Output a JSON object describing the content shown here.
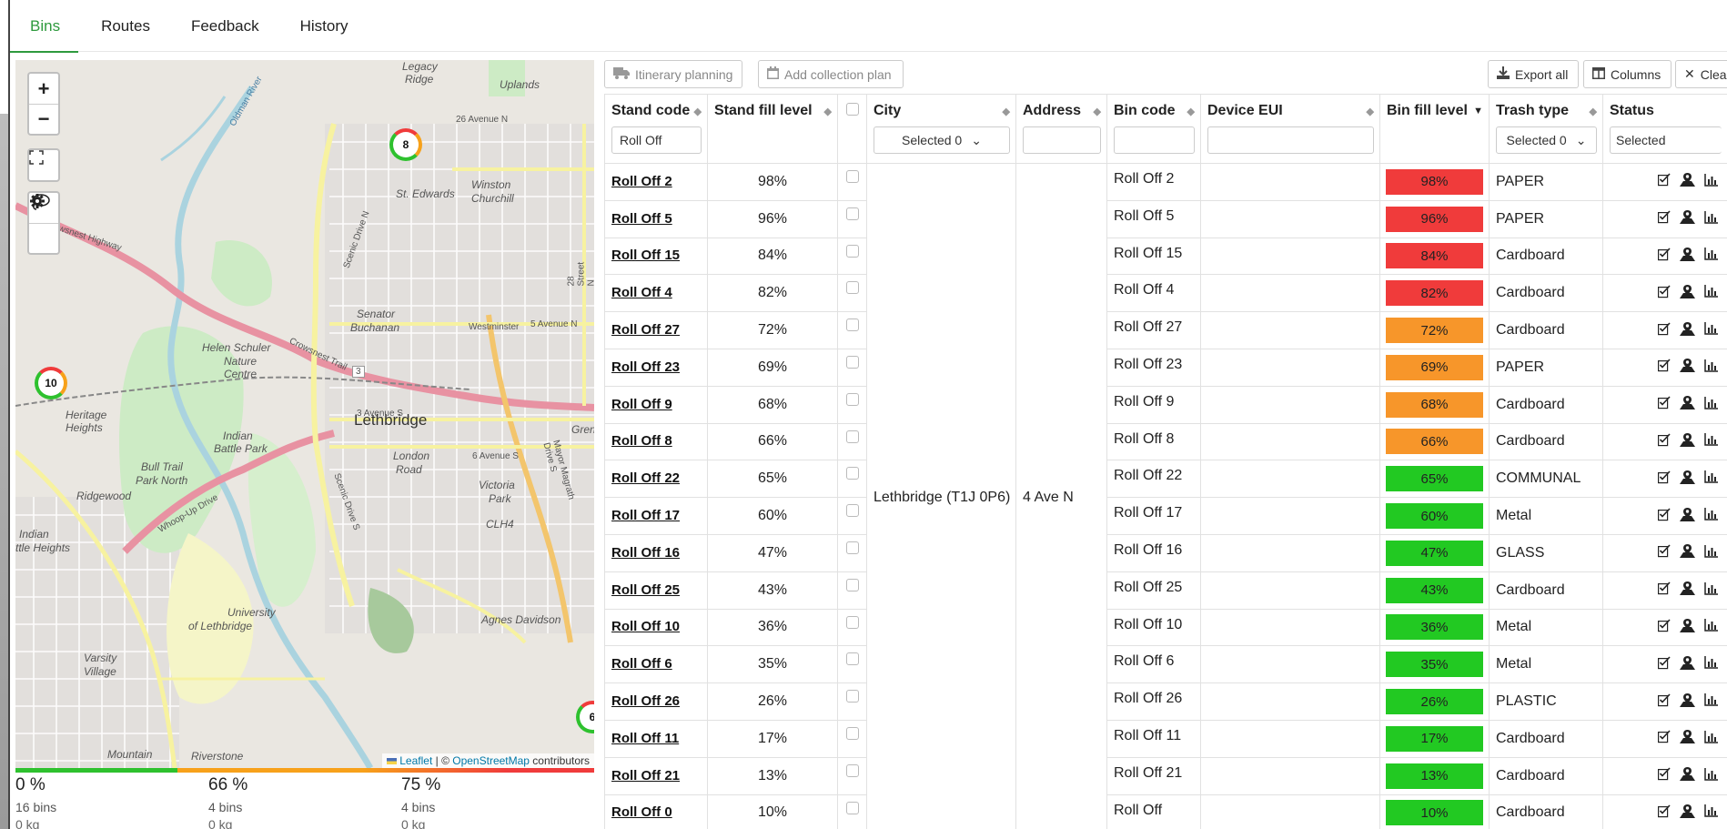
{
  "tabs": [
    {
      "label": "Bins",
      "active": true
    },
    {
      "label": "Routes",
      "active": false
    },
    {
      "label": "Feedback",
      "active": false
    },
    {
      "label": "History",
      "active": false
    }
  ],
  "map": {
    "zoom_in": "+",
    "zoom_out": "−",
    "attribution": {
      "leaflet": "Leaflet",
      "sep": " | © ",
      "osm": "OpenStreetMap",
      "suffix": " contributors"
    },
    "clusters": [
      {
        "count": "8",
        "color": "#2ec12e"
      },
      {
        "count": "10",
        "color": "#2ec12e"
      },
      {
        "count": "6",
        "color": "#2ec12e"
      }
    ],
    "labels": {
      "lethbridge": "Lethbridge",
      "senator": "Senator",
      "buchanan": "Buchanan",
      "helen": "Helen Schuler",
      "nature": "Nature",
      "centre": "Centre",
      "indian_battle": "Indian",
      "battle_park": "Battle Park",
      "bull_trail": "Bull Trail",
      "park_north": "Park North",
      "ridgewood": "Ridgewood",
      "indian_heights": "Indian",
      "battle_heights": "ttle Heights",
      "university": "University",
      "of_lethbridge": "of Lethbridge",
      "varsity": "Varsity",
      "village": "Village",
      "victoria": "Victoria",
      "park": "Park",
      "heritage": "Heritage",
      "heights": "Heights",
      "st_edwards": "St. Edwards",
      "winston": "Winston",
      "churchill": "Churchill",
      "uplands": "Uplands",
      "legacy": "Legacy",
      "ridge": "Ridge",
      "london": "London",
      "road": "Road",
      "agnes": "Agnes Davidson",
      "riverstone": "Riverstone",
      "mountain": "Mountain",
      "chl4": "CLH4",
      "gren": "Gren",
      "av26": "26 Avenue N",
      "westminster": "Westminster",
      "av5n": "5 Avenue N",
      "av3s": "3 Avenue S",
      "av6s": "6 Avenue S",
      "crowsnest": "Crowsnest Highway",
      "crowsnest_trail": "Crowsnest Trail",
      "scenic_n": "Scenic Drive N",
      "scenic_s": "Scenic Drive S",
      "mayor": "Mayor Magrath Drive S",
      "whoop": "Whoop-Up Drive",
      "oldman": "Oldman River",
      "st28": "28 Street N",
      "hwy3": "3"
    }
  },
  "stats": [
    {
      "pct": "0 %",
      "bins": "16 bins",
      "kg": "0 kg"
    },
    {
      "pct": "66 %",
      "bins": "4 bins",
      "kg": "0 kg"
    },
    {
      "pct": "75 %",
      "bins": "4 bins",
      "kg": "0 kg"
    }
  ],
  "toolbar": {
    "itinerary": "Itinerary planning",
    "collection": "Add collection plan",
    "export": "Export all",
    "columns": "Columns",
    "clear": "Clea"
  },
  "table": {
    "headers": {
      "stand_code": "Stand code",
      "stand_fill": "Stand fill level",
      "city": "City",
      "address": "Address",
      "bin_code": "Bin code",
      "device_eui": "Device EUI",
      "bin_fill": "Bin fill level",
      "trash_type": "Trash type",
      "status": "Status"
    },
    "filters": {
      "stand_code_value": "Roll Off",
      "city_select": "Selected 0",
      "trash_select": "Selected 0",
      "status_select": "Selected"
    },
    "merged": {
      "city": "Lethbridge (T1J 0P6)",
      "address": "4 Ave N"
    },
    "colors": {
      "red": "#f03b3b",
      "orange": "#f7962a",
      "green": "#22c922"
    },
    "rows": [
      {
        "stand": "Roll Off 2",
        "stand_fill": "98%",
        "bin": "Roll Off 2",
        "fill": "98%",
        "level": "red",
        "trash": "PAPER"
      },
      {
        "stand": "Roll Off 5",
        "stand_fill": "96%",
        "bin": "Roll Off 5",
        "fill": "96%",
        "level": "red",
        "trash": "PAPER"
      },
      {
        "stand": "Roll Off 15",
        "stand_fill": "84%",
        "bin": "Roll Off 15",
        "fill": "84%",
        "level": "red",
        "trash": "Cardboard"
      },
      {
        "stand": "Roll Off 4",
        "stand_fill": "82%",
        "bin": "Roll Off 4",
        "fill": "82%",
        "level": "red",
        "trash": "Cardboard"
      },
      {
        "stand": "Roll Off 27",
        "stand_fill": "72%",
        "bin": "Roll Off 27",
        "fill": "72%",
        "level": "orange",
        "trash": "Cardboard"
      },
      {
        "stand": "Roll Off 23",
        "stand_fill": "69%",
        "bin": "Roll Off 23",
        "fill": "69%",
        "level": "orange",
        "trash": "PAPER"
      },
      {
        "stand": "Roll Off 9",
        "stand_fill": "68%",
        "bin": "Roll Off 9",
        "fill": "68%",
        "level": "orange",
        "trash": "Cardboard"
      },
      {
        "stand": "Roll Off 8",
        "stand_fill": "66%",
        "bin": "Roll Off 8",
        "fill": "66%",
        "level": "orange",
        "trash": "Cardboard"
      },
      {
        "stand": "Roll Off 22",
        "stand_fill": "65%",
        "bin": "Roll Off 22",
        "fill": "65%",
        "level": "green",
        "trash": "COMMUNAL"
      },
      {
        "stand": "Roll Off 17",
        "stand_fill": "60%",
        "bin": "Roll Off 17",
        "fill": "60%",
        "level": "green",
        "trash": "Metal"
      },
      {
        "stand": "Roll Off 16",
        "stand_fill": "47%",
        "bin": "Roll Off 16",
        "fill": "47%",
        "level": "green",
        "trash": "GLASS"
      },
      {
        "stand": "Roll Off 25",
        "stand_fill": "43%",
        "bin": "Roll Off 25",
        "fill": "43%",
        "level": "green",
        "trash": "Cardboard"
      },
      {
        "stand": "Roll Off 10",
        "stand_fill": "36%",
        "bin": "Roll Off 10",
        "fill": "36%",
        "level": "green",
        "trash": "Metal"
      },
      {
        "stand": "Roll Off 6",
        "stand_fill": "35%",
        "bin": "Roll Off 6",
        "fill": "35%",
        "level": "green",
        "trash": "Metal"
      },
      {
        "stand": "Roll Off 26",
        "stand_fill": "26%",
        "bin": "Roll Off 26",
        "fill": "26%",
        "level": "green",
        "trash": "PLASTIC"
      },
      {
        "stand": "Roll Off 11",
        "stand_fill": "17%",
        "bin": "Roll Off 11",
        "fill": "17%",
        "level": "green",
        "trash": "Cardboard"
      },
      {
        "stand": "Roll Off 21",
        "stand_fill": "13%",
        "bin": "Roll Off 21",
        "fill": "13%",
        "level": "green",
        "trash": "Cardboard"
      },
      {
        "stand": "Roll Off 0",
        "stand_fill": "10%",
        "bin": "Roll Off",
        "fill": "10%",
        "level": "green",
        "trash": "Cardboard"
      }
    ]
  }
}
